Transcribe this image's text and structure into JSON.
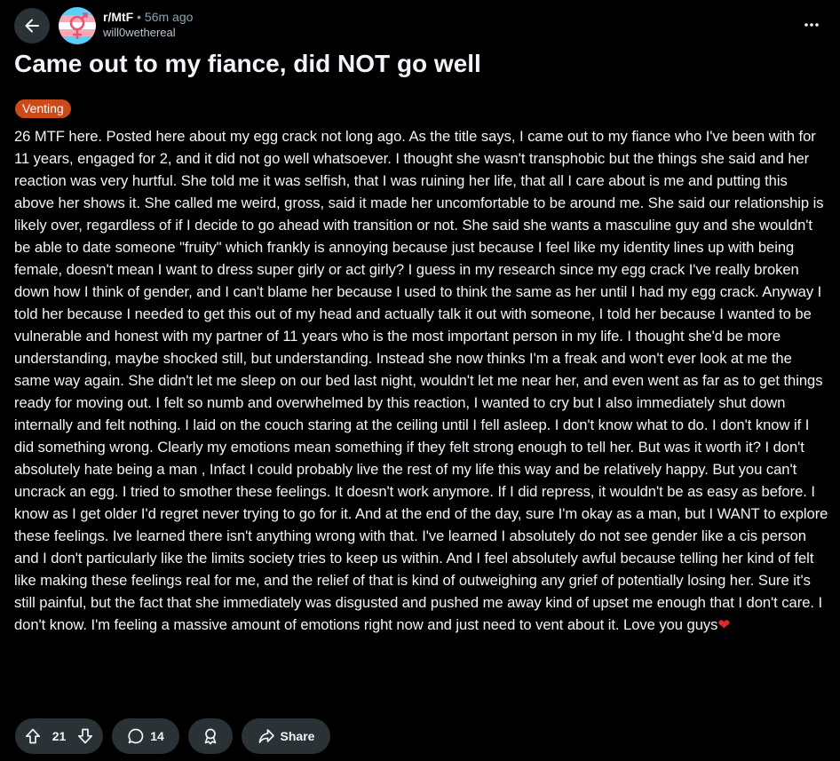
{
  "header": {
    "subreddit": "r/MtF",
    "separator": "•",
    "time_ago": "56m ago",
    "username": "will0wethereal",
    "avatar_colors": [
      "#5bcefa",
      "#f5a9b8",
      "#ffffff"
    ]
  },
  "post": {
    "title": "Came out to my fiance, did NOT go well",
    "flair": "Venting",
    "flair_color": "#cc4a17",
    "body": "26 MTF here. Posted here about my egg crack not long ago. As the title says, I came out to my fiance who I've been with for 11 years, engaged for 2, and it did not go well whatsoever. I thought she wasn't transphobic but the things she said and her reaction was very hurtful. She told me it was selfish, that I was ruining her life, that all I care about is me and putting this above her shows it. She called me weird, gross, said it made her uncomfortable to be around me. She said our relationship is likely over, regardless of if I decide to go ahead with transition or not. She said she wants a masculine guy and she wouldn't be able to date someone \"fruity\" which frankly is annoying because just because I feel like my identity lines up with being female, doesn't mean I want to dress super girly or act girly? I guess in my research since my egg crack I've really broken down how I think of gender, and I can't blame her because I used to think the same as her until I had my egg crack. Anyway I told her because I needed to get this out of my head and actually talk it out with someone, I told her because I wanted to be vulnerable and honest with my partner of 11 years who is the most important person in my life. I thought she'd be more understanding, maybe shocked still, but understanding. Instead she now thinks I'm a freak and won't ever look at me the same way again. She didn't let me sleep on our bed last night, wouldn't let me near her, and even went as far as to get things ready for moving out. I felt so numb and overwhelmed by this reaction, I wanted to cry but I also immediately shut down internally and felt nothing. I laid on the couch staring at the ceiling until I fell asleep. I don't know what to do. I don't know if I did something wrong. Clearly my emotions mean something if they felt strong enough to tell her. But was it worth it? I don't absolutely hate being a man , Infact I could probably live the rest of my life this way and be relatively happy. But you can't uncrack an egg. I tried to smother these feelings. It doesn't work anymore. If I did repress, it wouldn't be as easy as before. I know as I get older I'd regret never trying to go for it. And at the end of the day, sure I'm okay as a man, but I WANT to explore these feelings. Ive learned there isn't anything wrong with that. I've learned I absolutely do not see gender like a cis person and I don't particularly like the limits society tries to keep us within. And I feel absolutely awful because telling her kind of felt like making these feelings real for me, and the relief of that is kind of outweighing any grief of potentially losing her. Sure it's still painful, but the fact that she immediately was disgusted and pushed me away kind of upset me enough that I don't care. I don't know. I'm feeling a massive amount of emotions right now and just need to vent about it. Love you guys",
    "emoji": "❤"
  },
  "actions": {
    "vote_count": "21",
    "comment_count": "14",
    "share_label": "Share"
  },
  "icons": {
    "back": "arrow-left-icon",
    "more": "more-horizontal-icon",
    "upvote": "upvote-arrow-icon",
    "downvote": "downvote-arrow-icon",
    "comment": "comment-bubble-icon",
    "award": "award-icon",
    "share": "share-arrow-icon"
  },
  "colors": {
    "background": "#000000",
    "button_background": "#2a3236",
    "text": "#f2f4f5",
    "muted_text": "#8ba2ad"
  }
}
